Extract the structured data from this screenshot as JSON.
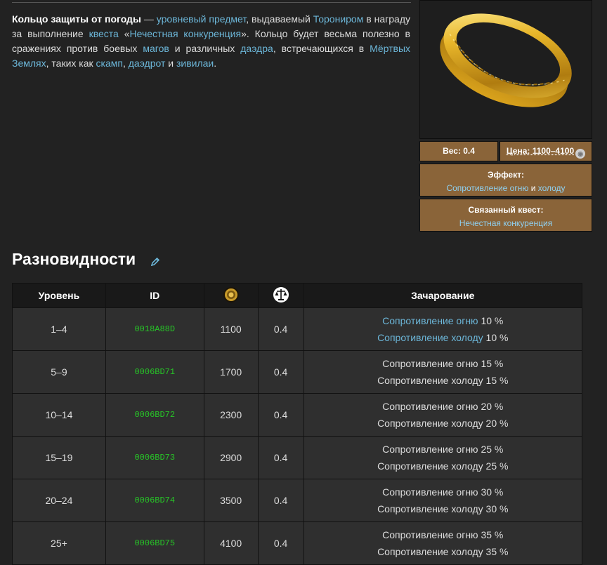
{
  "intro": {
    "parts": [
      {
        "t": "b",
        "v": "Кольцо защиты от погоды"
      },
      {
        "t": "s",
        "v": " — "
      },
      {
        "t": "a",
        "v": "уровневый предмет"
      },
      {
        "t": "s",
        "v": ", выдаваемый "
      },
      {
        "t": "a",
        "v": "Торониром"
      },
      {
        "t": "s",
        "v": " в награду за выполнение "
      },
      {
        "t": "a",
        "v": "квеста"
      },
      {
        "t": "s",
        "v": " «"
      },
      {
        "t": "a",
        "v": "Нечестная конкуренция"
      },
      {
        "t": "s",
        "v": "». Кольцо будет весьма полезно в сражениях против боевых "
      },
      {
        "t": "a",
        "v": "магов"
      },
      {
        "t": "s",
        "v": " и различных "
      },
      {
        "t": "a",
        "v": "даэдра"
      },
      {
        "t": "s",
        "v": ", встречающихся в "
      },
      {
        "t": "a",
        "v": "Мёртвых Землях"
      },
      {
        "t": "s",
        "v": ", таких как "
      },
      {
        "t": "a",
        "v": "скамп"
      },
      {
        "t": "s",
        "v": ", "
      },
      {
        "t": "a",
        "v": "даэдрот"
      },
      {
        "t": "s",
        "v": " и "
      },
      {
        "t": "a",
        "v": "зивилаи"
      },
      {
        "t": "s",
        "v": "."
      }
    ]
  },
  "infobox": {
    "weight": "Вес: 0.4",
    "price": "Цена: 1100–4100",
    "effect_title": "Эффект:",
    "effect_link1": "Сопротивление огню",
    "effect_and": " и ",
    "effect_link2": "холоду",
    "quest_title": "Связанный квест:",
    "quest_link": "Нечестная конкуренция"
  },
  "section": {
    "title": "Разновидности"
  },
  "table": {
    "headers": {
      "level": "Уровень",
      "id": "ID",
      "enchant": "Зачарование"
    },
    "rows": [
      {
        "level": "1–4",
        "id": "0018A88D",
        "price": "1100",
        "weight": "0.4",
        "ench1": "Сопротивление огню",
        "ench1_val": " 10 %",
        "ench2": "Сопротивление холоду",
        "ench2_val": " 10 %",
        "linked": true
      },
      {
        "level": "5–9",
        "id": "0006BD71",
        "price": "1700",
        "weight": "0.4",
        "ench1": "Сопротивление огню",
        "ench1_val": " 15 %",
        "ench2": "Сопротивление холоду",
        "ench2_val": " 15 %",
        "linked": false
      },
      {
        "level": "10–14",
        "id": "0006BD72",
        "price": "2300",
        "weight": "0.4",
        "ench1": "Сопротивление огню",
        "ench1_val": " 20 %",
        "ench2": "Сопротивление холоду",
        "ench2_val": " 20 %",
        "linked": false
      },
      {
        "level": "15–19",
        "id": "0006BD73",
        "price": "2900",
        "weight": "0.4",
        "ench1": "Сопротивление огню",
        "ench1_val": " 25 %",
        "ench2": "Сопротивление холоду",
        "ench2_val": " 25 %",
        "linked": false
      },
      {
        "level": "20–24",
        "id": "0006BD74",
        "price": "3500",
        "weight": "0.4",
        "ench1": "Сопротивление огню",
        "ench1_val": " 30 %",
        "ench2": "Сопротивление холоду",
        "ench2_val": " 30 %",
        "linked": false
      },
      {
        "level": "25+",
        "id": "0006BD75",
        "price": "4100",
        "weight": "0.4",
        "ench1": "Сопротивление огню",
        "ench1_val": " 35 %",
        "ench2": "Сопротивление холоду",
        "ench2_val": " 35 %",
        "linked": false
      }
    ]
  },
  "colors": {
    "link": "#6cb6d8",
    "id_green": "#27c427",
    "infobox_brown": "#8a6439",
    "gold": "#e0b020"
  },
  "icons": {
    "price_header": "gold-coin-icon",
    "weight_header": "scales-icon",
    "edit": "pencil-icon",
    "ring": "gold-ring-image"
  }
}
